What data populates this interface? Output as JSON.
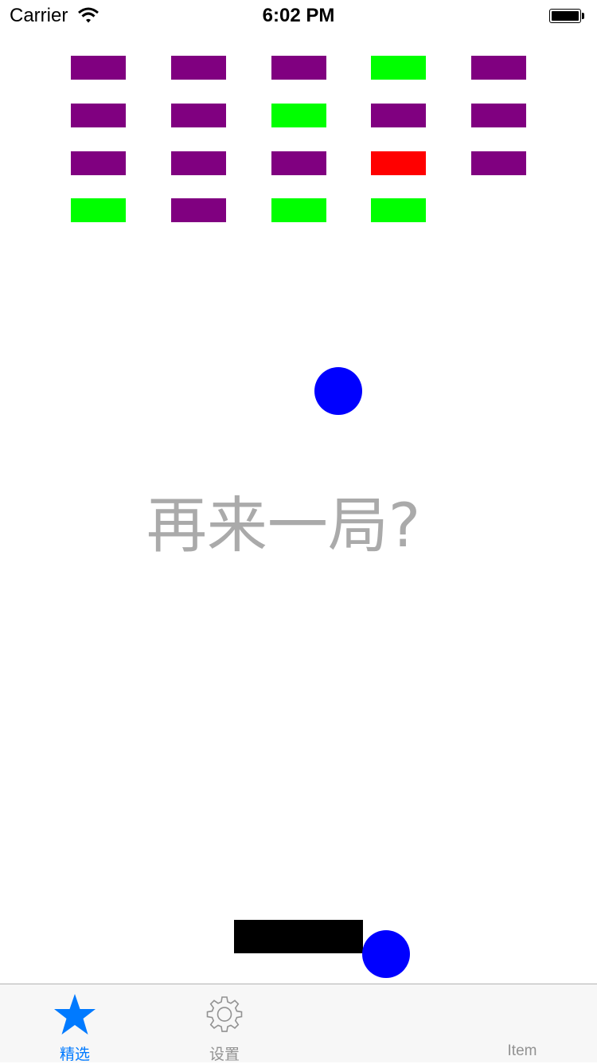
{
  "status_bar": {
    "carrier": "Carrier",
    "time": "6:02 PM"
  },
  "game": {
    "bricks": [
      {
        "row": 0,
        "col": 0,
        "color": "#800080"
      },
      {
        "row": 0,
        "col": 1,
        "color": "#800080"
      },
      {
        "row": 0,
        "col": 2,
        "color": "#800080"
      },
      {
        "row": 0,
        "col": 3,
        "color": "#00ff00"
      },
      {
        "row": 0,
        "col": 4,
        "color": "#800080"
      },
      {
        "row": 1,
        "col": 0,
        "color": "#800080"
      },
      {
        "row": 1,
        "col": 1,
        "color": "#800080"
      },
      {
        "row": 1,
        "col": 2,
        "color": "#00ff00"
      },
      {
        "row": 1,
        "col": 3,
        "color": "#800080"
      },
      {
        "row": 1,
        "col": 4,
        "color": "#800080"
      },
      {
        "row": 2,
        "col": 0,
        "color": "#800080"
      },
      {
        "row": 2,
        "col": 1,
        "color": "#800080"
      },
      {
        "row": 2,
        "col": 2,
        "color": "#800080"
      },
      {
        "row": 2,
        "col": 3,
        "color": "#ff0000"
      },
      {
        "row": 2,
        "col": 4,
        "color": "#800080"
      },
      {
        "row": 3,
        "col": 0,
        "color": "#00ff00"
      },
      {
        "row": 3,
        "col": 1,
        "color": "#800080"
      },
      {
        "row": 3,
        "col": 2,
        "color": "#00ff00"
      },
      {
        "row": 3,
        "col": 3,
        "color": "#00ff00"
      }
    ],
    "ball_color": "#0000ff",
    "paddle_color": "#000000",
    "retry_text": "再来一局?"
  },
  "tab_bar": {
    "tabs": [
      {
        "label": "精选",
        "icon": "star-icon",
        "active": true
      },
      {
        "label": "设置",
        "icon": "gear-icon",
        "active": false
      },
      {
        "label": "",
        "icon": "",
        "active": false
      },
      {
        "label": "Item",
        "icon": "",
        "active": false
      }
    ],
    "accent_color": "#007aff"
  }
}
